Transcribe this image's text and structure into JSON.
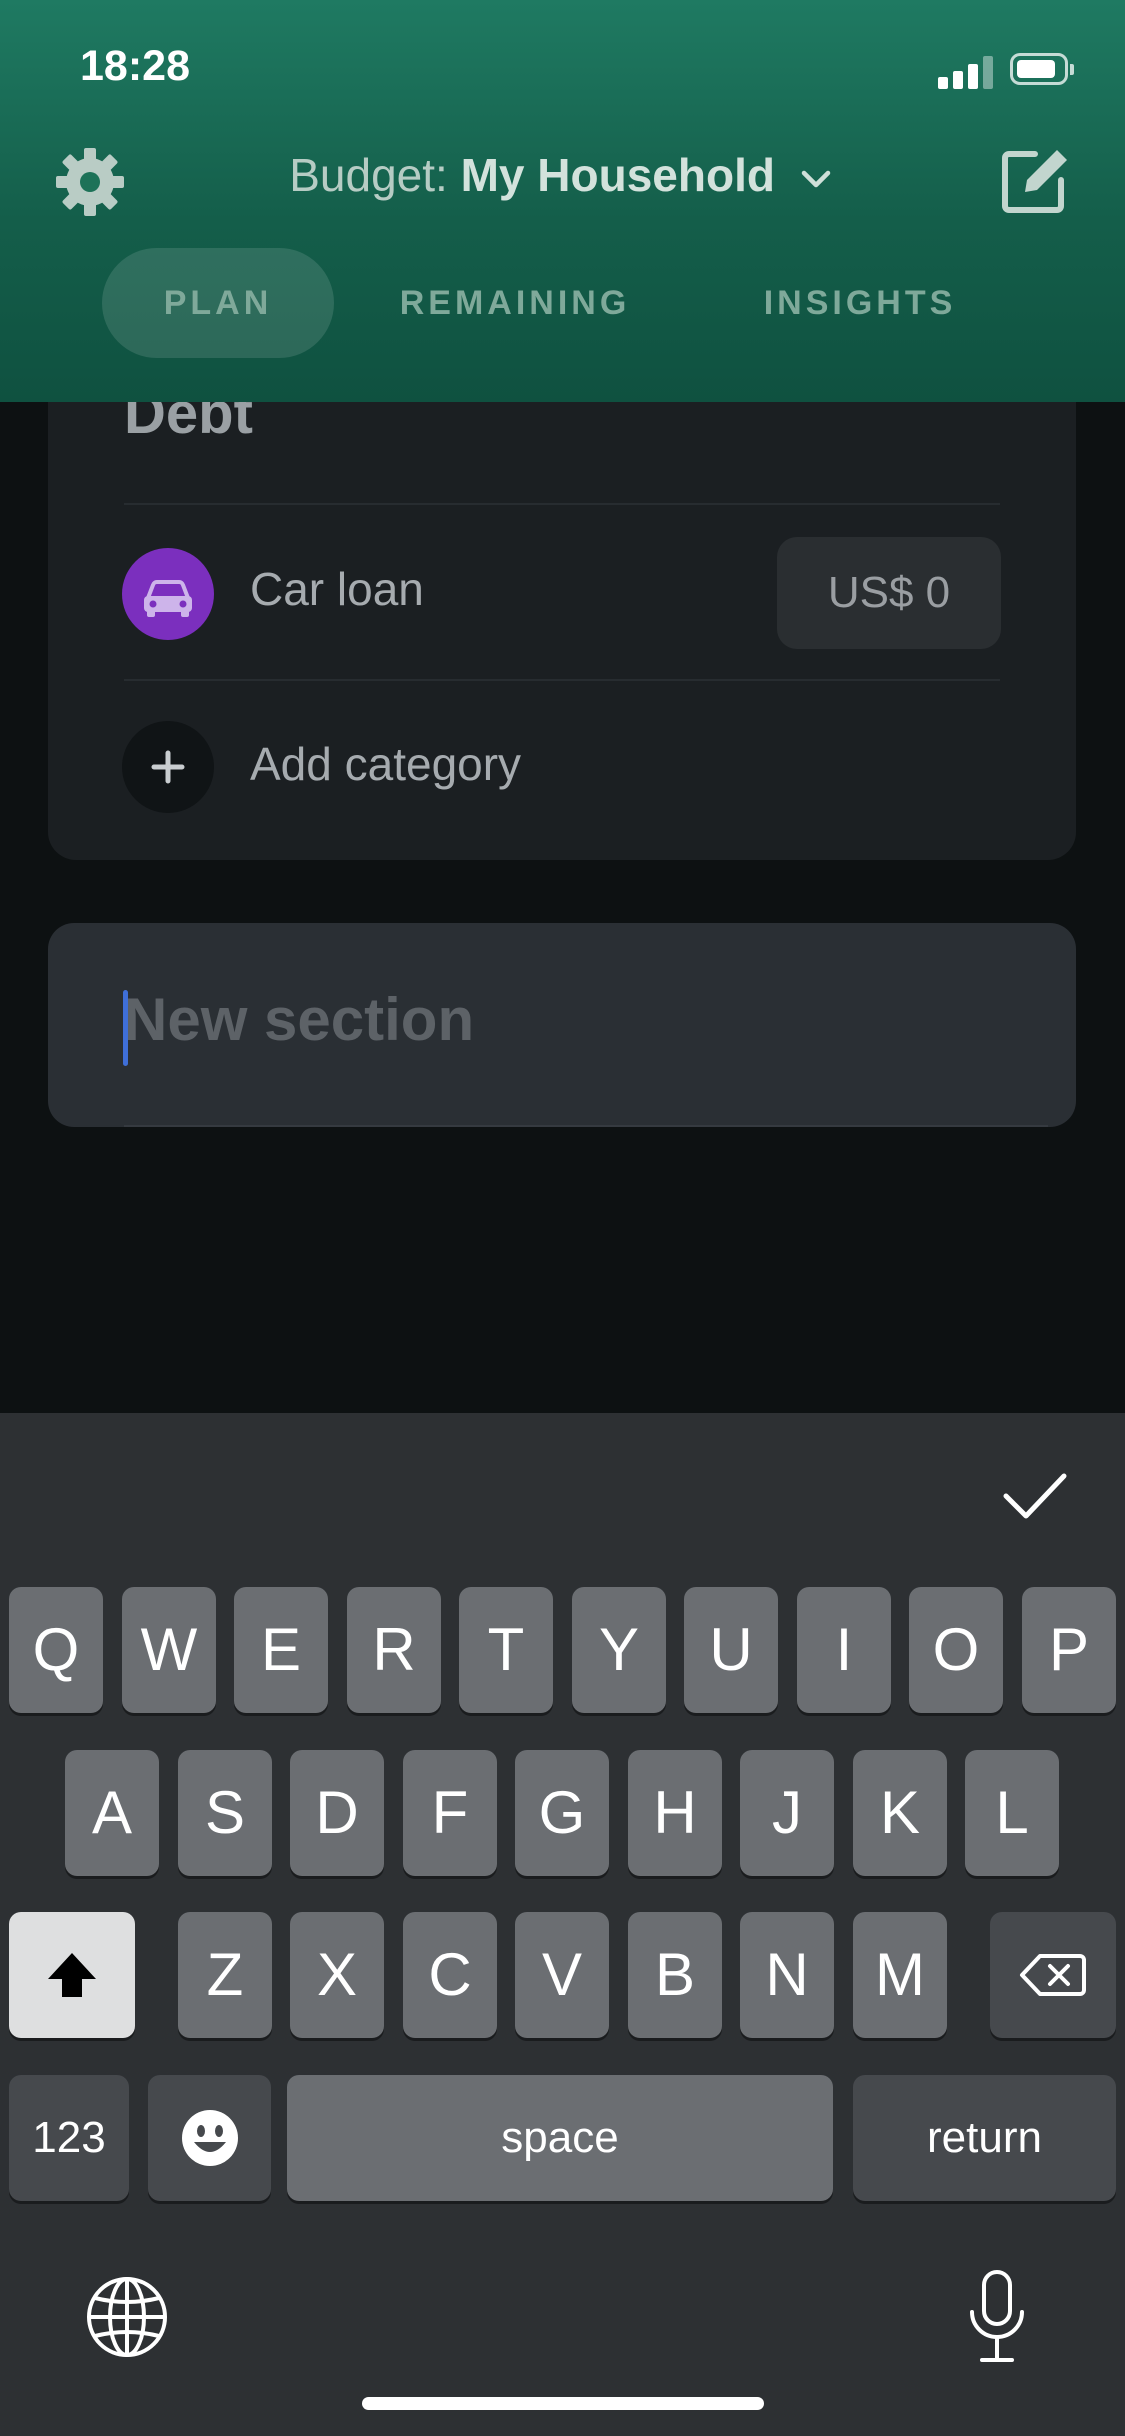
{
  "status_bar": {
    "time": "18:28"
  },
  "header": {
    "budget_prefix": "Budget:",
    "budget_name": "My Household",
    "settings_icon": "gear-icon",
    "edit_icon": "compose-icon"
  },
  "tabs": [
    {
      "label": "PLAN",
      "active": true
    },
    {
      "label": "REMAINING",
      "active": false
    },
    {
      "label": "INSIGHTS",
      "active": false
    }
  ],
  "section": {
    "title": "Debt",
    "categories": [
      {
        "label": "Car loan",
        "amount": "US$ 0",
        "icon": "car-icon",
        "icon_color": "#7b2fbe"
      }
    ],
    "add_label": "Add category"
  },
  "new_section": {
    "placeholder": "New section"
  },
  "keyboard": {
    "row1": [
      "Q",
      "W",
      "E",
      "R",
      "T",
      "Y",
      "U",
      "I",
      "O",
      "P"
    ],
    "row2": [
      "A",
      "S",
      "D",
      "F",
      "G",
      "H",
      "J",
      "K",
      "L"
    ],
    "row3": [
      "Z",
      "X",
      "C",
      "V",
      "B",
      "N",
      "M"
    ],
    "numbers_label": "123",
    "space_label": "space",
    "return_label": "return"
  }
}
